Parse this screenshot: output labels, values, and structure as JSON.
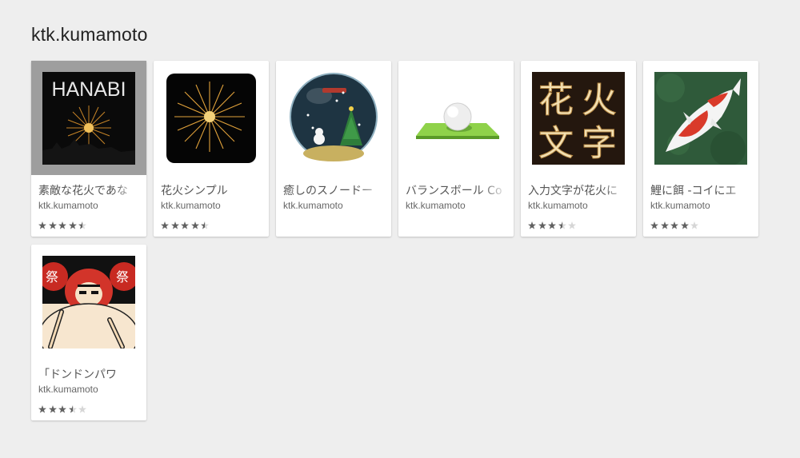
{
  "developer": {
    "name": "ktk.kumamoto"
  },
  "colors": {
    "star_filled": "#616161",
    "star_empty": "#d6d6d6",
    "page_bg": "#eeeeee"
  },
  "apps": [
    {
      "title": "素敵な花火であな",
      "developer": "ktk.kumamoto",
      "rating": 4.5,
      "icon": "hanabi-fireworks-icon",
      "icon_text": "HANABI"
    },
    {
      "title": "花火シンプル",
      "developer": "ktk.kumamoto",
      "rating": 4.5,
      "icon": "firework-burst-icon"
    },
    {
      "title": "癒しのスノードー",
      "developer": "ktk.kumamoto",
      "rating": null,
      "icon": "snow-globe-icon"
    },
    {
      "title": "バランスボール Co",
      "developer": "ktk.kumamoto",
      "rating": null,
      "icon": "balance-ball-icon"
    },
    {
      "title": "入力文字が花火に",
      "developer": "ktk.kumamoto",
      "rating": 3.5,
      "icon": "firework-letters-icon",
      "icon_text": "花火文字"
    },
    {
      "title": "鯉に餌 -コイにエ",
      "developer": "ktk.kumamoto",
      "rating": 4,
      "icon": "koi-fish-icon"
    },
    {
      "title": "「ドンドンパワ",
      "developer": "ktk.kumamoto",
      "rating": 3.5,
      "icon": "daruma-drum-icon",
      "icon_text": "祭"
    }
  ]
}
